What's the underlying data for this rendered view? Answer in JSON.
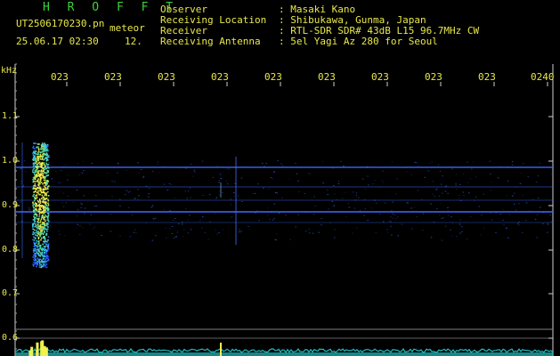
{
  "header": {
    "app_title": "H R O F F T",
    "filename": "UT2506170230.pn",
    "tag": "meteor",
    "datetime": "25.06.17 02:30",
    "count": "12.",
    "fields": [
      {
        "label": "Observer",
        "value": ": Masaki Kano"
      },
      {
        "label": "Receiving Location",
        "value": ": Shibukawa, Gunma, Japan"
      },
      {
        "label": "Receiver",
        "value": ": RTL-SDR SDR# 43dB L15 96.7MHz CW"
      },
      {
        "label": "Receiving Antenna",
        "value": ": 5el Yagi Az 280 for Seoul"
      }
    ]
  },
  "axis": {
    "unit": "kHz",
    "y_labels": [
      "1.1",
      "1.0",
      "0.9",
      "0.8",
      "0.7",
      "0.6"
    ],
    "time_labels": [
      "023",
      "023",
      "023",
      "023",
      "023",
      "023",
      "023",
      "023",
      "023",
      "0240"
    ]
  },
  "colors": {
    "text": "#e8e84a",
    "title": "#3cd23c",
    "axis_line": "#d0d0d0",
    "trace": "#3a6cff",
    "meteor_hot": "#f0f050",
    "noise_floor": "#20c0c0"
  }
}
